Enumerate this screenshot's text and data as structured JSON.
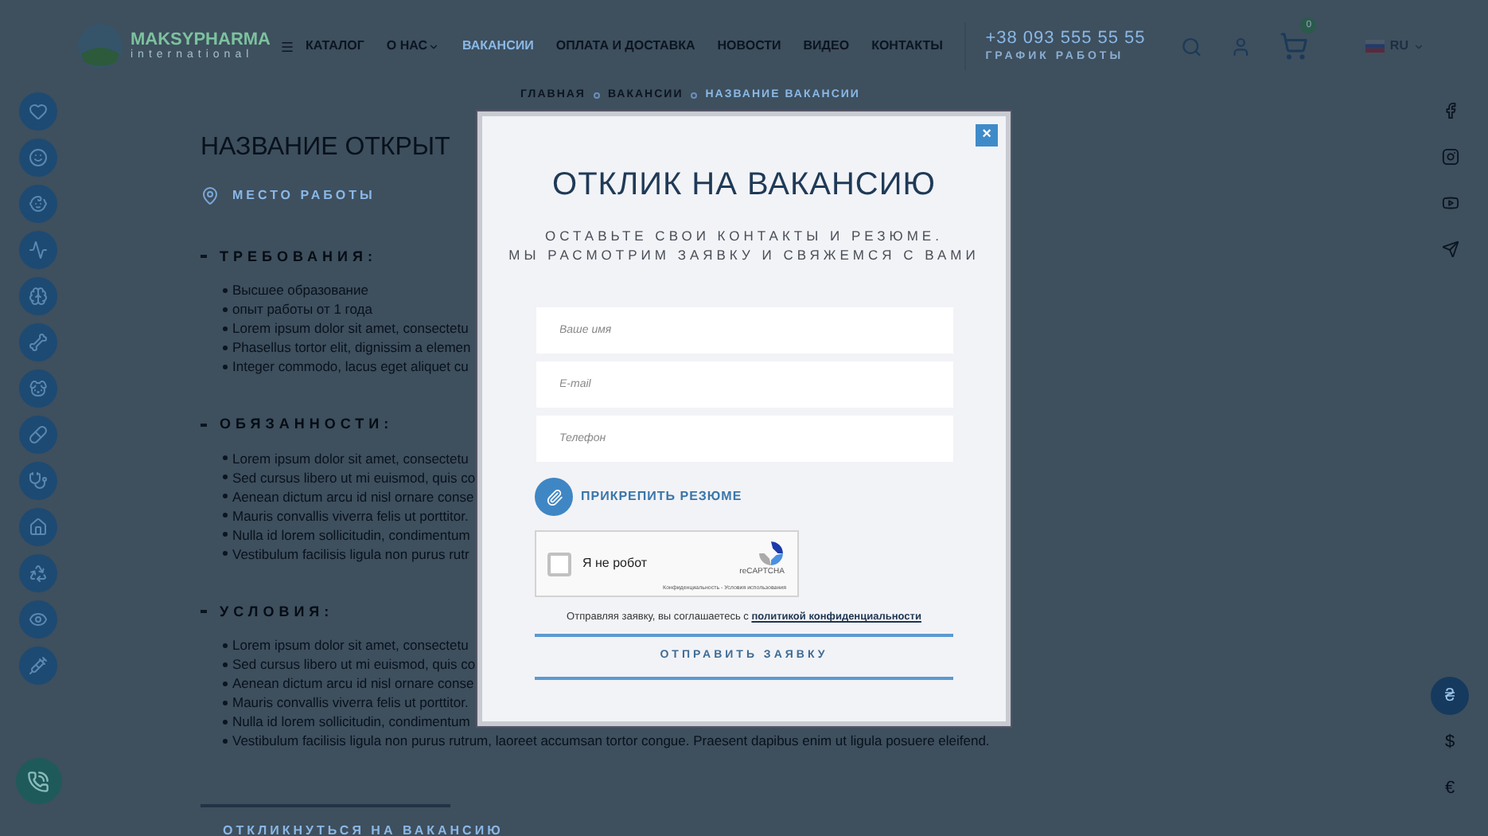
{
  "header": {
    "logo": {
      "name": "MAKSYPHARMA",
      "tagline": "international"
    },
    "nav": [
      {
        "label": "КАТАЛОГ",
        "selected": false,
        "dropdown": false,
        "menu_icon": true
      },
      {
        "label": "О НАС",
        "selected": false,
        "dropdown": true,
        "menu_icon": false
      },
      {
        "label": "ВАКАНСИИ",
        "selected": true,
        "dropdown": false,
        "menu_icon": false
      },
      {
        "label": "ОПЛАТА И ДОСТАВКА",
        "selected": false,
        "dropdown": false,
        "menu_icon": false
      },
      {
        "label": "НОВОСТИ",
        "selected": false,
        "dropdown": false,
        "menu_icon": false
      },
      {
        "label": "ВИДЕО",
        "selected": false,
        "dropdown": false,
        "menu_icon": false
      },
      {
        "label": "КОНТАКТЫ",
        "selected": false,
        "dropdown": false,
        "menu_icon": false
      }
    ],
    "phone": "+38 093 555 55 55",
    "schedule": "ГРАФИК РАБОТЫ",
    "cart_count": "0",
    "language": "RU"
  },
  "breadcrumbs": [
    {
      "label": "ГЛАВНАЯ",
      "selected": false
    },
    {
      "label": "ВАКАНСИИ",
      "selected": false
    },
    {
      "label": "НАЗВАНИЕ ВАКАНСИИ",
      "selected": true
    }
  ],
  "vacancy": {
    "title": "НАЗВАНИЕ ОТКРЫТ",
    "location": "МЕСТО РАБОТЫ",
    "sections": [
      {
        "heading": "ТРЕБОВАНИЯ:",
        "items": [
          "Высшее образование",
          "опыт работы от 1 года",
          "Lorem ipsum dolor sit amet, consectetu",
          "Phasellus tortor elit, dignissim a elemen",
          "Integer commodo, lacus eget aliquet cu"
        ]
      },
      {
        "heading": "ОБЯЗАННОСТИ:",
        "items": [
          "Lorem ipsum dolor sit amet, consectetu",
          "Sed cursus libero ut mi euismod, quis co",
          "Aenean dictum arcu id nisl ornare conse",
          "Mauris convallis viverra felis ut porttitor.",
          "Nulla id lorem sollicitudin, condimentum",
          "Vestibulum facilisis ligula non purus rutr"
        ]
      },
      {
        "heading": "УСЛОВИЯ:",
        "items": [
          "Lorem ipsum dolor sit amet, consectetu",
          "Sed cursus libero ut mi euismod, quis co",
          "Aenean dictum arcu id nisl ornare conse",
          "Mauris convallis viverra felis ut porttitor.",
          "Nulla id lorem sollicitudin, condimentum",
          "Vestibulum facilisis ligula non purus rutrum, laoreet accumsan tortor congue. Praesent dapibus enim ut ligula posuere eleifend."
        ]
      }
    ],
    "apply_link": "ОТКЛИКНУТЬСЯ НА ВАКАНСИЮ"
  },
  "currencies": [
    {
      "symbol": "₴",
      "selected": true
    },
    {
      "symbol": "$",
      "selected": false
    },
    {
      "symbol": "€",
      "selected": false
    }
  ],
  "modal": {
    "close": "×",
    "title": "ОТКЛИК НА ВАКАНСИЮ",
    "subtitle": [
      "ОСТАВЬТЕ СВОИ КОНТАКТЫ И РЕЗЮМЕ.",
      "МЫ РАСМОТРИМ ЗАЯВКУ И СВЯЖЕМСЯ С ВАМИ"
    ],
    "fields": [
      {
        "placeholder": "Ваше имя"
      },
      {
        "placeholder": "E-mail"
      },
      {
        "placeholder": "Телефон"
      }
    ],
    "attach": "ПРИКРЕПИТЬ РЕЗЮМЕ",
    "captcha": {
      "label": "Я не робот",
      "checked": false,
      "brand": "reCAPTCHA",
      "terms": "Конфиденциальность - Условия использования"
    },
    "consent": {
      "text": "Отправляя заявку, вы соглашаетесь с",
      "link": "политикой конфиденциальности"
    },
    "submit": "ОТПРАВИТЬ ЗАЯВКУ"
  }
}
